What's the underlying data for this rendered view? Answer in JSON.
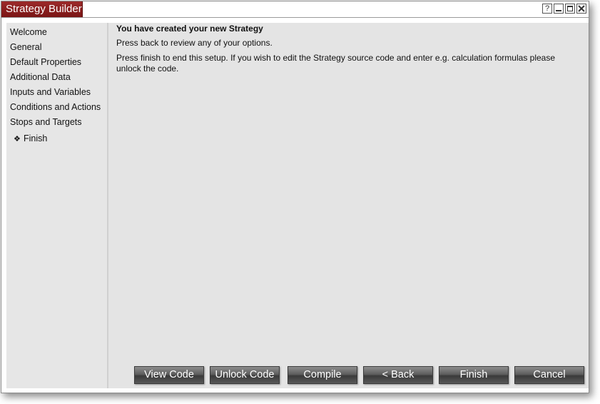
{
  "window": {
    "title": "Strategy Builder",
    "help_glyph": "?"
  },
  "sidebar": {
    "items": [
      {
        "label": "Welcome"
      },
      {
        "label": "General"
      },
      {
        "label": "Default Properties"
      },
      {
        "label": "Additional Data"
      },
      {
        "label": "Inputs and Variables"
      },
      {
        "label": "Conditions and Actions"
      },
      {
        "label": "Stops and Targets"
      },
      {
        "label": "Finish",
        "current": true,
        "bullet": "❖"
      }
    ]
  },
  "main": {
    "heading": "You have created your new Strategy",
    "line1": "Press back to review any of your options.",
    "line2": "Press finish to end this setup. If you wish to edit the Strategy source code and enter e.g. calculation formulas please unlock the code."
  },
  "buttons": {
    "view_code": "View Code",
    "unlock_code": "Unlock Code",
    "compile": "Compile",
    "back": "< Back",
    "finish": "Finish",
    "cancel": "Cancel"
  },
  "colors": {
    "title_tab": "#8b1d1d",
    "panel_bg": "#e4e4e4",
    "button_dark": "#4a4a4a"
  },
  "icons": [
    "help-icon",
    "minimize-icon",
    "maximize-icon",
    "close-icon",
    "diamond-bullet-icon"
  ]
}
